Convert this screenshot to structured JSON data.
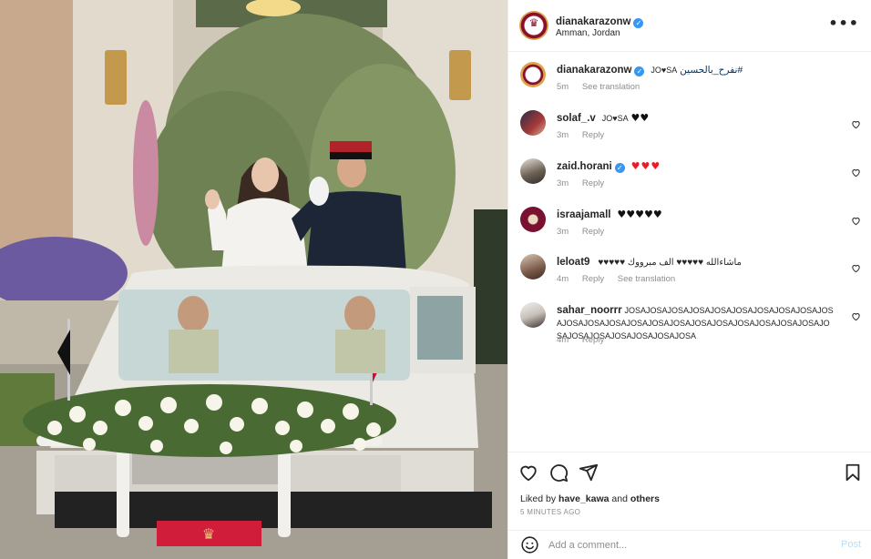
{
  "post": {
    "author": "dianakarazonw",
    "location": "Amman, Jordan",
    "photo_alt": "Wedding couple waving from an open white vehicle decorated with flowers",
    "plate_emblem": "crown-emblem"
  },
  "caption": {
    "username": "dianakarazonw",
    "hashtag": "#نفرح_بالحسين",
    "text": "JO♥SA",
    "time": "5m",
    "see_translation": "See translation"
  },
  "comments": [
    {
      "username": "solaf_.v",
      "text": "JO♥SA",
      "hearts": "♥♥",
      "time": "3m",
      "reply": "Reply"
    },
    {
      "username": "zaid.horani",
      "hearts": "♥♥♥",
      "time": "3m",
      "reply": "Reply"
    },
    {
      "username": "israajamall",
      "hearts": "♥♥♥♥♥",
      "time": "3m",
      "reply": "Reply"
    },
    {
      "username": "leloat9",
      "text": "ماشاءالله ♥♥♥♥♥ الف مبرووك ♥♥♥♥♥",
      "time": "4m",
      "reply": "Reply",
      "see_translation": "See translation"
    },
    {
      "username": "sahar_noorrr",
      "text": "JOSAJOSAJOSAJOSAJOSAJOSAJOSAJOSAJOSAJOSAJOSAJOSAJOSAJOSAJOSAJOSAJOSAJOSAJOSAJOSAJOSAJOSAJOSAJOSAJOSAJOSAJOSAJOSAJOSA",
      "time": "4m",
      "reply": "Reply"
    }
  ],
  "actions": {
    "liked_by_prefix": "Liked by",
    "liked_by_user": "have_kawa",
    "liked_by_suffix": "and",
    "others": "others",
    "timestamp": "5 MINUTES AGO"
  },
  "composer": {
    "placeholder": "Add a comment...",
    "post_label": "Post"
  },
  "colors": {
    "link_blue": "#00376b",
    "verified_blue": "#3897f0",
    "heart_red": "#ed1c24",
    "post_disabled": "#b2dffc",
    "muted": "#8e8e8e"
  }
}
